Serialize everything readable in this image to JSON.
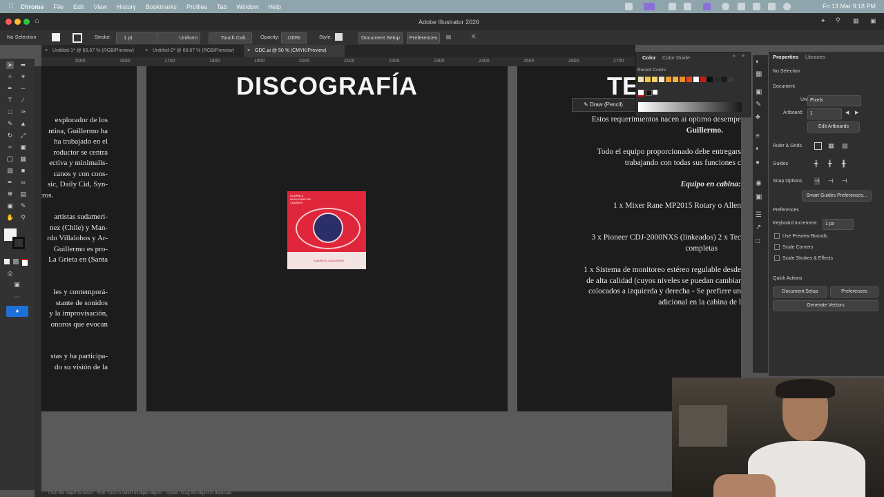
{
  "menubar": {
    "app": "Chrome",
    "items": [
      "File",
      "Edit",
      "View",
      "History",
      "Bookmarks",
      "Profiles",
      "Tab",
      "Window",
      "Help"
    ],
    "clock": "Fri 13 Mar  9:18 PM"
  },
  "window": {
    "title": "Adobe Illustrator 2026"
  },
  "controlbar": {
    "selection": "No Selection",
    "stroke_label": "Stroke:",
    "stroke_value": "1 pt",
    "profile": "Uniform",
    "brush": "Touch Call...",
    "opacity_label": "Opacity:",
    "opacity_value": "100%",
    "style_label": "Style:",
    "document_setup": "Document Setup",
    "preferences": "Preferences"
  },
  "tabs": [
    {
      "label": "Untitled-1* @ 66,67 % (RGB/Preview)"
    },
    {
      "label": "Untitled-2* @ 66,67 % (RGB/Preview)"
    },
    {
      "label": "GDC.ai @ 50 % (CMYK/Preview)"
    }
  ],
  "ruler": {
    "ticks": [
      "1500",
      "1600",
      "1700",
      "1800",
      "1900",
      "2000",
      "2100",
      "2200",
      "2300",
      "2400",
      "2500",
      "2600",
      "2700"
    ]
  },
  "artboard_left": {
    "lines": [
      "explorador de los",
      "ntina, Guillermo ha",
      "ha trabajado en el",
      "roductor se centra",
      "ectiva y minimalis-",
      "canos y con cons-",
      "sic, Daily Cid, Syn-",
      "tros.",
      "artistas sudameri-",
      "nez (Chile) y Man-",
      "rdo Villalobos y Ar-",
      "Guillermo es pro-",
      "La Grieta en (Santa",
      "les y contemporá-",
      "stante de sonidos",
      "y la improvisación,",
      "onoros que evocan",
      "stas y ha participa-",
      "do su visión de la"
    ]
  },
  "artboard_center": {
    "title": "DISCOGRAFÍA",
    "album_top": "GUARNI & GUILLERMO DE CAMINOS",
    "album_bottom": "GUARNI & GUILLERMO"
  },
  "artboard_right": {
    "title_fragment": "TE",
    "p1": "Estos requerimientos hacen al óptimo desempe",
    "p1b": "Guillermo.",
    "p2": "Todo el equipo proporcionado debe entregars",
    "p2b": "trabajando con todas sus funciones c",
    "heading": "Equipo en cabina:",
    "item1": "1 x Mixer Rane MP2015 Rotary o Allen",
    "item2": "3 x Pioneer CDJ-2000NXS (linkeados) 2 x Tec",
    "item2b": "completas",
    "item3": "1 x Sistema de monitoreo estéreo regulable desde",
    "item3b": "de alta calidad (cuyos niveles se puedan cambiar",
    "item3c": "colocados a izquierda y derecha  - Se prefiere un",
    "item3d": "adicional en la cabina de l"
  },
  "tooltip": {
    "label": "Draw (Pencil)"
  },
  "color_panel": {
    "tabs": [
      "Color",
      "Color Guide"
    ],
    "recent_label": "Recent Colors",
    "swatches": [
      "#f2e0b0",
      "#f5c542",
      "#f0a030",
      "#ff8a1f",
      "#e04a1a",
      "#ffffff",
      "#cc1a1a",
      "#101010",
      "#2a2a2a",
      "#1a1a1a",
      "#3a3a3a",
      "#222222"
    ]
  },
  "properties": {
    "tabs": [
      "Properties",
      "Libraries"
    ],
    "selection": "No Selection",
    "document": "Document",
    "units_label": "Units:",
    "units_value": "Pixels",
    "artboard_label": "Artboard:",
    "artboard_value": "1",
    "edit_artboards": "Edit Artboards",
    "ruler_grids": "Ruler & Grids",
    "guides": "Guides",
    "snap_options": "Snap Options",
    "smart_guides": "Smart Guides Preferences...",
    "preferences": "Preferences",
    "keyboard_increment_label": "Keyboard Increment:",
    "keyboard_increment_value": "1 px",
    "use_preview_bounds": "Use Preview Bounds",
    "scale_corners": "Scale Corners",
    "scale_strokes": "Scale Strokes & Effects",
    "quick_actions": "Quick Actions",
    "document_setup": "Document Setup",
    "preferences_btn": "Preferences",
    "generate_vectors": "Generate Vectors"
  },
  "statusbar": {
    "text": "Click the object to select · Shift: Click to select multiple objects · Option: Drag the object to duplicate"
  }
}
